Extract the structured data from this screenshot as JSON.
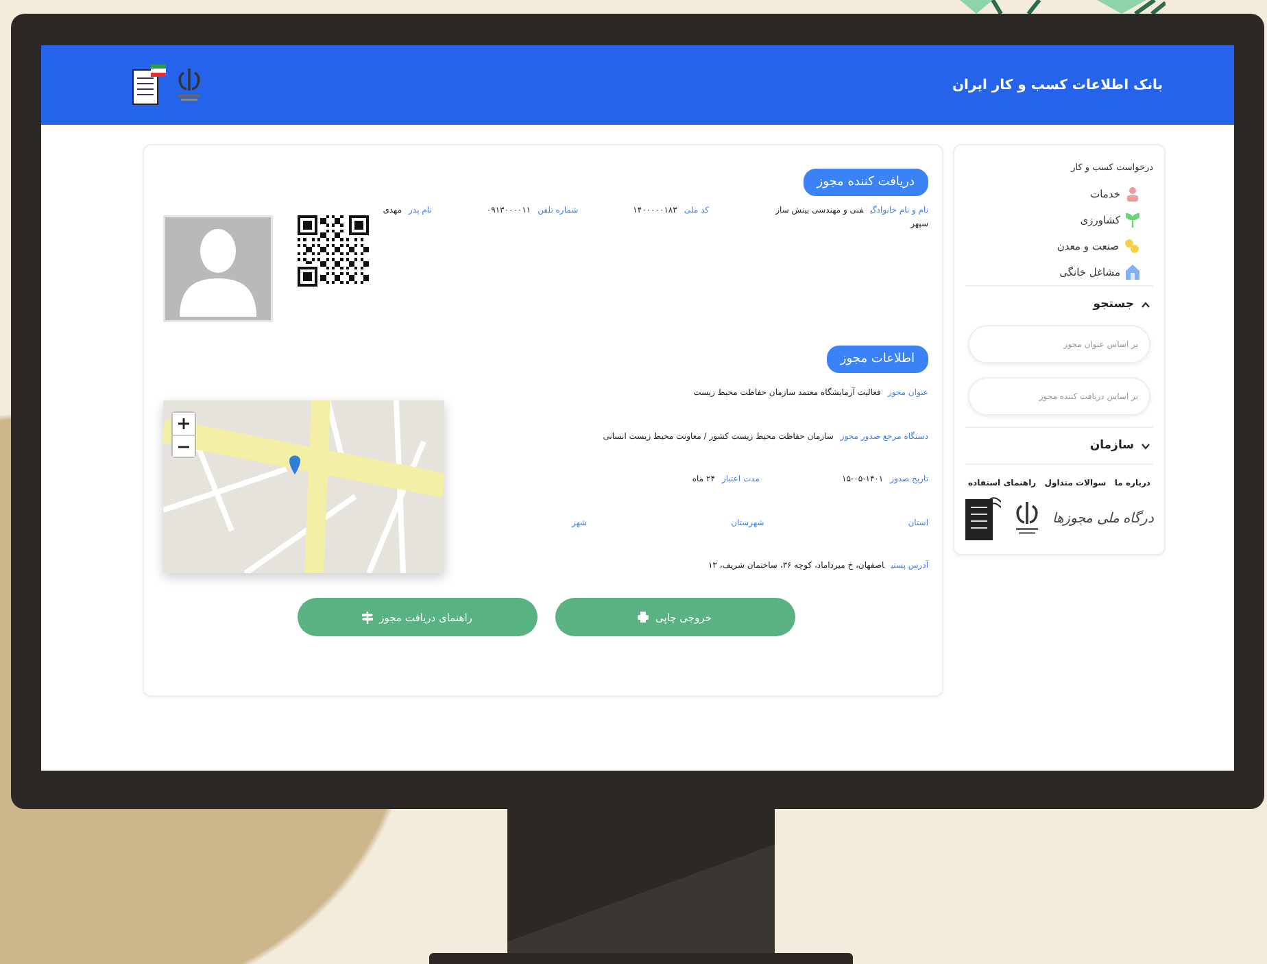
{
  "header": {
    "title": "بانک اطلاعات کسب و کار ایران"
  },
  "recipient": {
    "heading": "دریافت کننده مجوز",
    "fields": [
      {
        "label": "نام و نام خانوادگی",
        "value": "فنی و مهندسی بینش ساز سپهر"
      },
      {
        "label": "کد ملی",
        "value": "۱۴۰۰۰۰۰۱۸۳"
      },
      {
        "label": "شماره تلفن",
        "value": "۰۹۱۳۰۰۰۰۱۱"
      },
      {
        "label": "نام پدر",
        "value": "مهدی"
      }
    ]
  },
  "license": {
    "heading": "اطلاعات مجوز",
    "rows": [
      [
        {
          "label": "عنوان مجوز",
          "value": "فعالیت آزمایشگاه معتمد سازمان حفاظت محیط زیست"
        }
      ],
      [
        {
          "label": "دستگاه مرجع صدور مجوز",
          "value": "سازمان حفاظت محیط زیست کشور / معاونت محیط زیست انسانی"
        }
      ],
      [
        {
          "label": "تاریخ صدور",
          "value": "۱۴۰۱-۰۵-۱۵"
        },
        {
          "label": "مدت اعتبار",
          "value": "۲۴ ماه"
        }
      ],
      [
        {
          "label": "استان"
        },
        {
          "label": "شهرستان"
        },
        {
          "label": "شهر"
        }
      ],
      [
        {
          "label": "آدرس پستی",
          "value": "اصفهان، خ میرداماد، کوچه ۳۶، ساختمان شریف، ۱۳"
        }
      ]
    ]
  },
  "buttons": [
    {
      "label": "خروجی چاپی",
      "kind": "print"
    },
    {
      "label": "راهنمای دریافت مجوز",
      "kind": "guide"
    }
  ],
  "sidebar": {
    "heading": "درخواست کسب و کار",
    "categories": [
      {
        "label": "خدمات",
        "kind": "services"
      },
      {
        "label": "کشاورزی",
        "kind": "agriculture"
      },
      {
        "label": "صنعت و معدن",
        "kind": "industry"
      },
      {
        "label": "مشاغل خانگی",
        "kind": "home"
      }
    ],
    "sections": [
      {
        "title": "جستجو",
        "expanded": true,
        "fields": [
          {
            "placeholder": "بر اساس عنوان مجوز"
          },
          {
            "placeholder": "بر اساس دریافت کننده مجوز"
          }
        ]
      },
      {
        "title": "سازمان",
        "expanded": false
      }
    ],
    "links": [
      "درباره ما",
      "سوالات متداول",
      "راهنمای استفاده"
    ],
    "portal_logo": "درگاه ملی مجوزها"
  }
}
